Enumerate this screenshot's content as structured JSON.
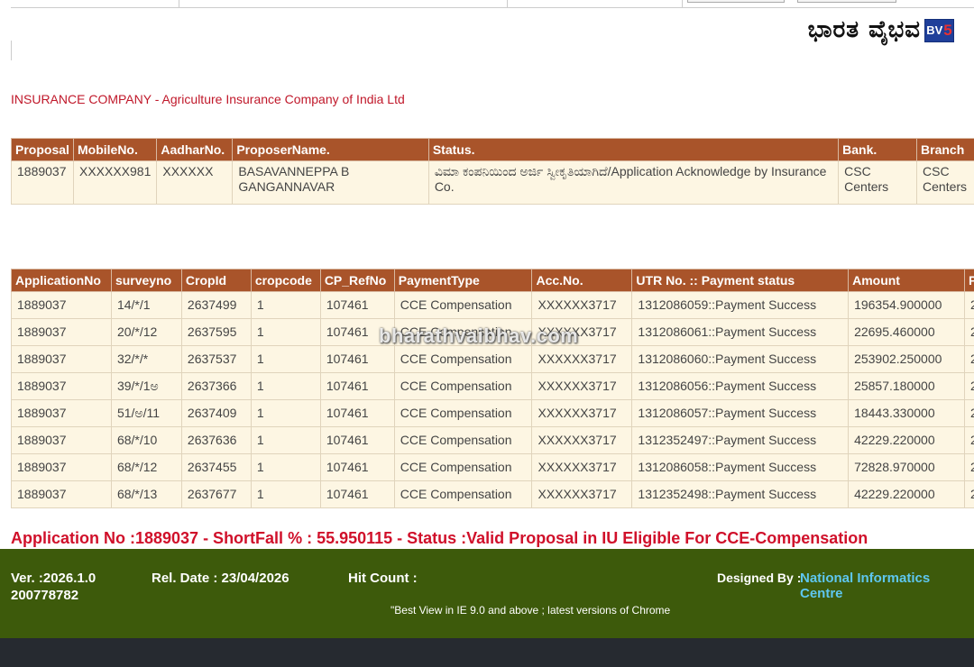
{
  "header": {
    "brand_text": "ಭಾರತ ವೈಭವ",
    "brand_logo_letters": "BV",
    "brand_logo_number": "5"
  },
  "insurance": {
    "label": "INSURANCE COMPANY - Agriculture Insurance Company of India Ltd"
  },
  "proposal_table": {
    "headers": [
      "Proposal",
      "MobileNo.",
      "AadharNo.",
      "ProposerName.",
      "Status.",
      "Bank.",
      "Branch"
    ],
    "rows": [
      [
        "1889037",
        "XXXXXX981",
        "XXXXXX",
        "BASAVANNEPPA B GANGANNAVAR",
        "ವಿಮಾ ಕಂಪನಿಯಿಂದ ಅರ್ಜಿ ಸ್ವೀಕೃತಿಯಾಗಿದೆ/Application Acknowledge by Insurance Co.",
        "CSC Centers",
        "CSC Centers"
      ]
    ]
  },
  "payment_table": {
    "headers": [
      "ApplicationNo",
      "surveyno",
      "CropId",
      "cropcode",
      "CP_RefNo",
      "PaymentType",
      "Acc.No.",
      "UTR No. :: Payment status",
      "Amount",
      "P"
    ],
    "rows": [
      [
        "1889037",
        "14/*/1",
        "2637499",
        "1",
        "107461",
        "CCE Compensation",
        "XXXXXX3717",
        "1312086059::Payment Success",
        "196354.900000",
        "2"
      ],
      [
        "1889037",
        "20/*/12",
        "2637595",
        "1",
        "107461",
        "CCE Compensation",
        "XXXXXX3717",
        "1312086061::Payment Success",
        "22695.460000",
        "2"
      ],
      [
        "1889037",
        "32/*/*",
        "2637537",
        "1",
        "107461",
        "CCE Compensation",
        "XXXXXX3717",
        "1312086060::Payment Success",
        "253902.250000",
        "2"
      ],
      [
        "1889037",
        "39/*/1ಅ",
        "2637366",
        "1",
        "107461",
        "CCE Compensation",
        "XXXXXX3717",
        "1312086056::Payment Success",
        "25857.180000",
        "2"
      ],
      [
        "1889037",
        "51/ಅ/11",
        "2637409",
        "1",
        "107461",
        "CCE Compensation",
        "XXXXXX3717",
        "1312086057::Payment Success",
        "18443.330000",
        "2"
      ],
      [
        "1889037",
        "68/*/10",
        "2637636",
        "1",
        "107461",
        "CCE Compensation",
        "XXXXXX3717",
        "1312352497::Payment Success",
        "42229.220000",
        "2"
      ],
      [
        "1889037",
        "68/*/12",
        "2637455",
        "1",
        "107461",
        "CCE Compensation",
        "XXXXXX3717",
        "1312086058::Payment Success",
        "72828.970000",
        "2"
      ],
      [
        "1889037",
        "68/*/13",
        "2637677",
        "1",
        "107461",
        "CCE Compensation",
        "XXXXXX3717",
        "1312352498::Payment Success",
        "42229.220000",
        "2"
      ]
    ]
  },
  "watermark": "bharathvaibhav.com",
  "summary": "Application No :1889037 - ShortFall % : 55.950115 - Status :Valid Proposal in IU Eligible For CCE-Compensation",
  "footer": {
    "version": "Ver. :2026.1.0",
    "build": "200778782",
    "rel_date": "Rel. Date : 23/04/2026",
    "hit_count": "Hit Count :",
    "designed_by": "Designed By :",
    "designer": "National Informatics Centre",
    "note": "\"Best View in IE 9.0 and above ; latest versions of Chrome"
  },
  "colors": {
    "table_header": "#a9542a",
    "footer_bg": "#3d5a0b",
    "summary_red": "#d0102a",
    "link_blue": "#5ec7f0"
  }
}
